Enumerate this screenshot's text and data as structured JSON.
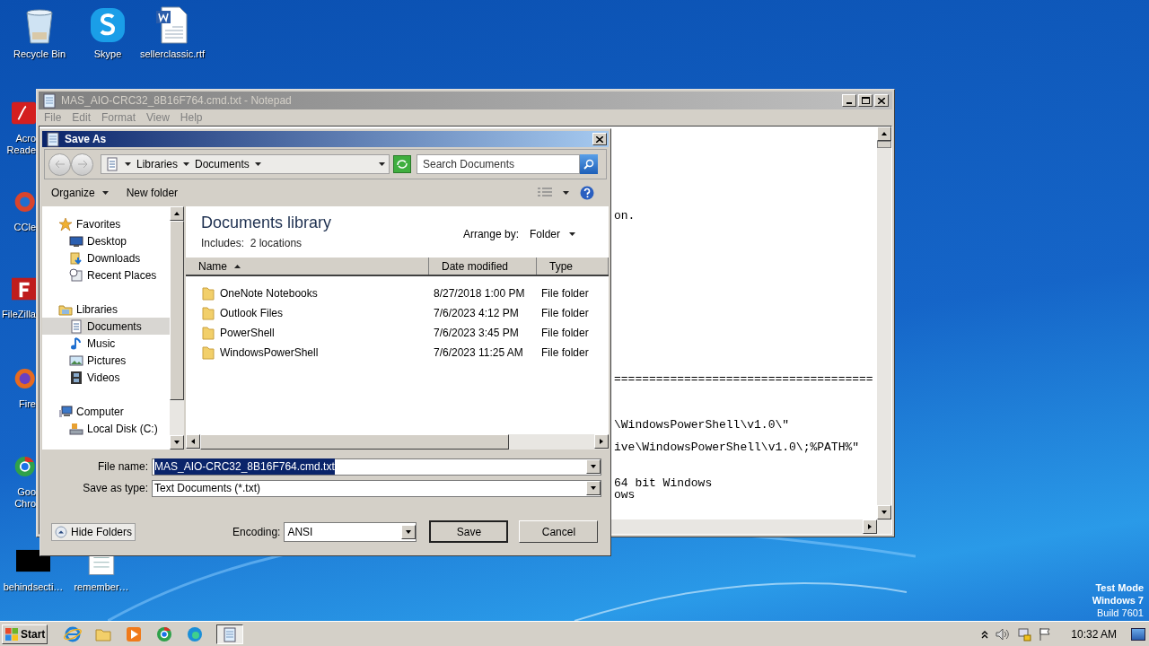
{
  "desktop": {
    "top_icons": [
      {
        "label": "Recycle Bin",
        "kind": "recycle"
      },
      {
        "label": "Skype",
        "kind": "skype"
      },
      {
        "label": "sellerclassic.rtf",
        "kind": "word"
      }
    ],
    "side_icons": [
      {
        "lines": [
          "Acro",
          "Reade"
        ],
        "kind": "reader"
      },
      {
        "lines": [
          "CCle"
        ],
        "kind": "cleaner"
      },
      {
        "lines": [
          "FileZilla"
        ],
        "kind": "filezilla"
      },
      {
        "lines": [
          "Fire"
        ],
        "kind": "firefox"
      },
      {
        "lines": [
          "Goo",
          "Chro"
        ],
        "kind": "chrome"
      }
    ],
    "bottom_icons": [
      {
        "label": "behindsecti…",
        "kind": "black"
      },
      {
        "label": "remember…",
        "kind": "doc"
      }
    ],
    "os_notice": [
      "Test Mode",
      "Windows 7",
      "Build 7601"
    ]
  },
  "notepad": {
    "title": "MAS_AIO-CRC32_8B16F764.cmd.txt - Notepad",
    "menu": [
      "File",
      "Edit",
      "Format",
      "View",
      "Help"
    ],
    "lines": [
      "on.",
      "=====================================",
      "\\WindowsPowerShell\\v1.0\\\"",
      "ive\\WindowsPowerShell\\v1.0\\;%PATH%\"",
      "64 bit Windows",
      "ows"
    ]
  },
  "dialog": {
    "title": "Save As",
    "breadcrumb": [
      "Libraries",
      "Documents"
    ],
    "search": {
      "placeholder": "Search Documents"
    },
    "toolbar": {
      "organize": "Organize",
      "new_folder": "New folder"
    },
    "nav": [
      {
        "label": "Favorites",
        "kind": "star",
        "selected": false,
        "children": [
          {
            "label": "Desktop",
            "kind": "desktop",
            "selected": false
          },
          {
            "label": "Downloads",
            "kind": "downloads",
            "selected": false
          },
          {
            "label": "Recent Places",
            "kind": "recent",
            "selected": false
          }
        ]
      },
      {
        "label": "Libraries",
        "kind": "libraries",
        "selected": false,
        "children": [
          {
            "label": "Documents",
            "kind": "documents",
            "selected": true
          },
          {
            "label": "Music",
            "kind": "music",
            "selected": false
          },
          {
            "label": "Pictures",
            "kind": "pictures",
            "selected": false
          },
          {
            "label": "Videos",
            "kind": "videos",
            "selected": false
          }
        ]
      },
      {
        "label": "Computer",
        "kind": "computer",
        "selected": false,
        "children": [
          {
            "label": "Local Disk (C:)",
            "kind": "disk",
            "selected": false
          }
        ]
      }
    ],
    "library": {
      "title": "Documents library",
      "includes": "Includes:  2 locations",
      "arrange_label": "Arrange by:",
      "arrange_value": "Folder"
    },
    "columns": [
      {
        "label": "Name",
        "sorted": true
      },
      {
        "label": "Date modified",
        "sorted": false
      },
      {
        "label": "Type",
        "sorted": false
      }
    ],
    "rows": [
      {
        "name": "OneNote Notebooks",
        "date": "8/27/2018 1:00 PM",
        "type": "File folder"
      },
      {
        "name": "Outlook Files",
        "date": "7/6/2023 4:12 PM",
        "type": "File folder"
      },
      {
        "name": "PowerShell",
        "date": "7/6/2023 3:45 PM",
        "type": "File folder"
      },
      {
        "name": "WindowsPowerShell",
        "date": "7/6/2023 11:25 AM",
        "type": "File folder"
      }
    ],
    "file_name": {
      "label": "File name:",
      "value": "MAS_AIO-CRC32_8B16F764.cmd.txt",
      "selected": true
    },
    "save_type": {
      "label": "Save as type:",
      "value": "Text Documents (*.txt)"
    },
    "hide_folders": "Hide Folders",
    "encoding": {
      "label": "Encoding:",
      "value": "ANSI"
    },
    "buttons": [
      {
        "label": "Save",
        "default": true
      },
      {
        "label": "Cancel",
        "default": false
      }
    ]
  },
  "taskbar": {
    "start": "Start",
    "apps": [
      {
        "kind": "ie",
        "active": false
      },
      {
        "kind": "explorer",
        "active": false
      },
      {
        "kind": "media",
        "active": false
      },
      {
        "kind": "chrome",
        "active": false
      },
      {
        "kind": "edge",
        "active": false
      },
      {
        "kind": "notepad",
        "active": true
      }
    ],
    "clock": "10:32 AM"
  }
}
